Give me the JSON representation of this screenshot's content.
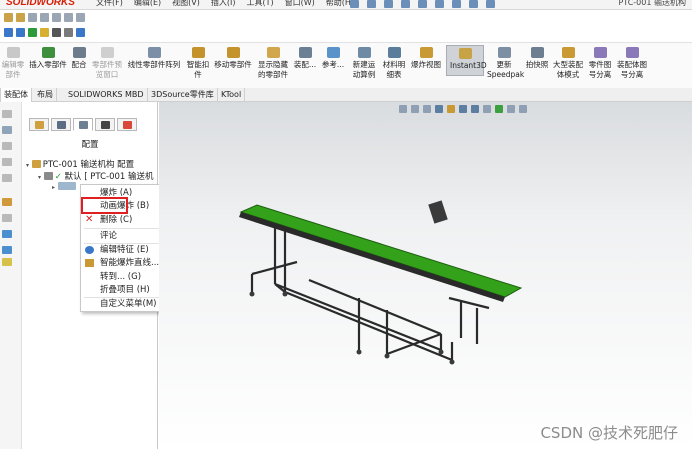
{
  "app": {
    "logo": "SOLIDWORKS",
    "menus": [
      "文件(F)",
      "编辑(E)",
      "视图(V)",
      "插入(I)",
      "工具(T)",
      "窗口(W)",
      "帮助(H)"
    ],
    "window_title": "PTC-001 输送机构"
  },
  "ribbon": [
    {
      "label": "编辑零部件",
      "enabled": false
    },
    {
      "label": "插入零部件",
      "enabled": true
    },
    {
      "label": "配合",
      "enabled": true
    },
    {
      "label": "零部件预览窗口",
      "enabled": false
    },
    {
      "label": "线性零部件阵列",
      "enabled": true
    },
    {
      "label": "智能扣件",
      "enabled": true
    },
    {
      "label": "移动零部件",
      "enabled": true
    },
    {
      "label": "显示隐藏的零部件",
      "enabled": true
    },
    {
      "label": "装配...",
      "enabled": true
    },
    {
      "label": "参考...",
      "enabled": true
    },
    {
      "label": "新建运动算例",
      "enabled": true
    },
    {
      "label": "材料明细表",
      "enabled": true
    },
    {
      "label": "爆炸视图",
      "enabled": true
    },
    {
      "label": "Instant3D",
      "enabled": true,
      "active": true
    },
    {
      "label": "更新Speedpak",
      "enabled": true
    },
    {
      "label": "拍快照",
      "enabled": true
    },
    {
      "label": "大型装配体模式",
      "enabled": true
    },
    {
      "label": "零件图号分离",
      "enabled": true
    },
    {
      "label": "装配体图号分离",
      "enabled": true
    }
  ],
  "tabs": [
    "装配体",
    "布局",
    "SOLIDWORKS MBD",
    "3DSource零件库",
    "KTool"
  ],
  "panel": {
    "title": "配置",
    "tree": [
      {
        "label": "PTC-001 输送机构 配置"
      },
      {
        "label": "默认 [ PTC-001 输送机"
      }
    ]
  },
  "context_menu": {
    "items": [
      {
        "label": "爆炸 (A)",
        "icon": "none"
      },
      {
        "label": "动画爆炸 (B)",
        "icon": "none"
      },
      {
        "label": "删除 (C)",
        "icon": "delete-icon"
      },
      {
        "label": "评论",
        "icon": "none",
        "submenu": true
      },
      {
        "label": "编辑特征 (E)",
        "icon": "edit-feature-icon"
      },
      {
        "label": "智能爆炸直线... (F)",
        "icon": "smart-explode-icon"
      },
      {
        "label": "转到... (G)",
        "icon": "none"
      },
      {
        "label": "折叠项目 (H)",
        "icon": "none"
      },
      {
        "label": "自定义菜单(M)",
        "icon": "none"
      }
    ],
    "highlighted": "动画爆炸 (B)",
    "highlight_color": "#e02020"
  },
  "colors": {
    "conveyor_belt": "#33a11a",
    "frame": "#2a2a2a",
    "brand_red": "#d81e05"
  },
  "watermark": "CSDN @技术死肥仔"
}
